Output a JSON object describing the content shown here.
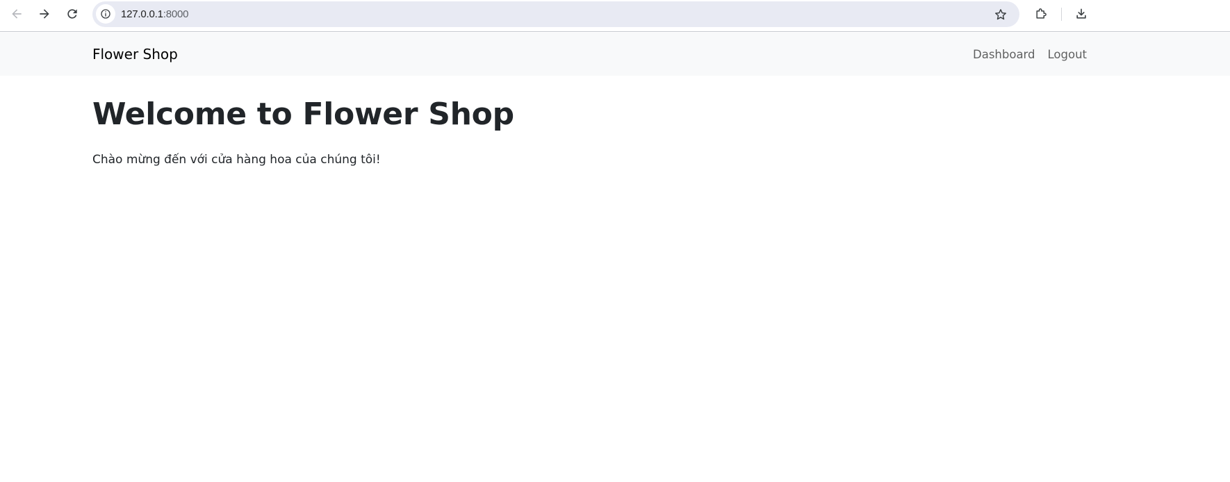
{
  "browser": {
    "url_host": "127.0.0.1",
    "url_port": ":8000",
    "icons": {
      "back": "arrow-left-icon",
      "forward": "arrow-right-icon",
      "reload": "reload-icon",
      "site_info": "info-icon",
      "bookmark": "star-icon",
      "extensions": "puzzle-icon",
      "download": "download-icon"
    }
  },
  "navbar": {
    "brand": "Flower Shop",
    "links": [
      {
        "label": "Dashboard"
      },
      {
        "label": "Logout"
      }
    ],
    "background": "#f8f9fa"
  },
  "main": {
    "title": "Welcome to Flower Shop",
    "subtitle": "Chào mừng đến với cửa hàng hoa của chúng tôi!"
  }
}
